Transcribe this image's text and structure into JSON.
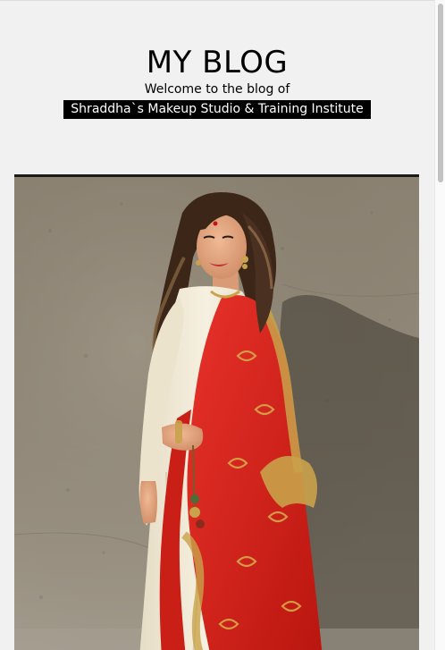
{
  "header": {
    "title": "MY BLOG",
    "welcome": "Welcome to the blog of",
    "studio": "Shraddha`s Makeup Studio & Training Institute"
  },
  "colors": {
    "page_background": "#f1f1f1",
    "label_background": "#000000",
    "label_text": "#ffffff",
    "dupatta_red": "#d8241f",
    "gold": "#c9a24a",
    "suit_cream": "#f1ead8",
    "wall": "#8d8474"
  },
  "photo": {
    "subject": "woman-in-red-dupatta-photo"
  }
}
